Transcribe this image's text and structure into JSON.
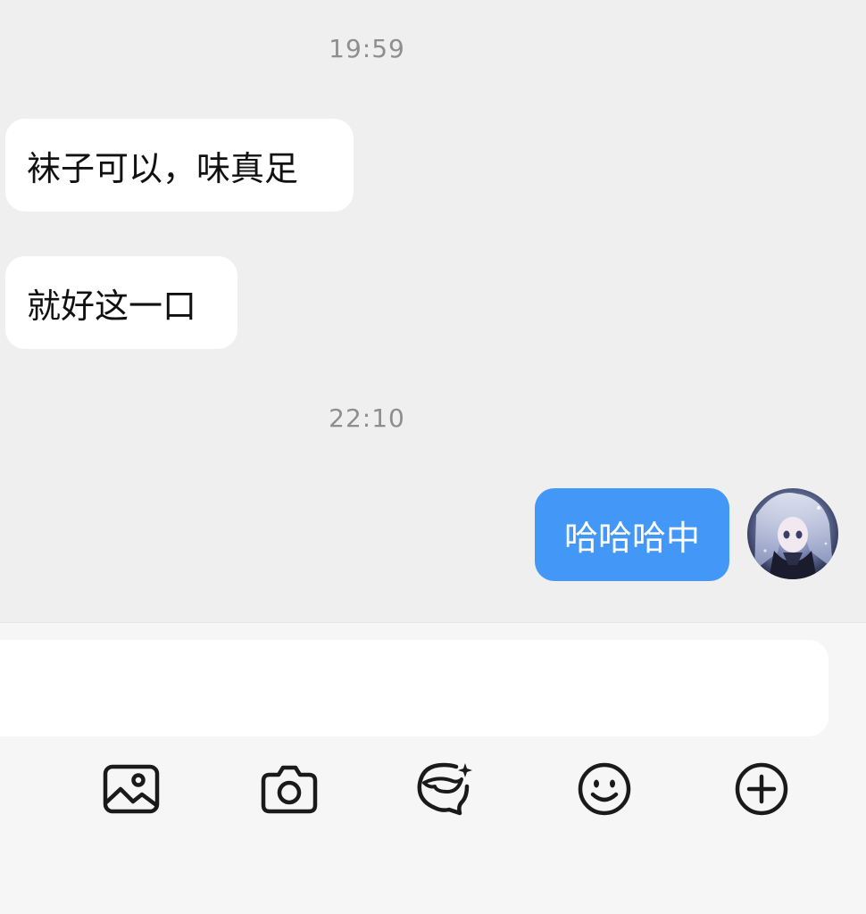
{
  "chat": {
    "timestamps": [
      "19:59",
      "22:10"
    ],
    "messages": [
      {
        "direction": "incoming",
        "text": "袜子可以，味真足"
      },
      {
        "direction": "incoming",
        "text": "就好这一口"
      },
      {
        "direction": "outgoing",
        "text": "哈哈哈中"
      }
    ]
  },
  "input": {
    "value": "",
    "placeholder": ""
  },
  "toolbar": {
    "icons": [
      "image-icon",
      "camera-icon",
      "ai-chat-icon",
      "emoji-icon",
      "plus-icon"
    ]
  },
  "colors": {
    "chat_background": "#efefef",
    "incoming_bubble": "#ffffff",
    "outgoing_bubble": "#4398f7",
    "timestamp_text": "#8e8e8e",
    "icon_stroke": "#1a1a1a"
  }
}
